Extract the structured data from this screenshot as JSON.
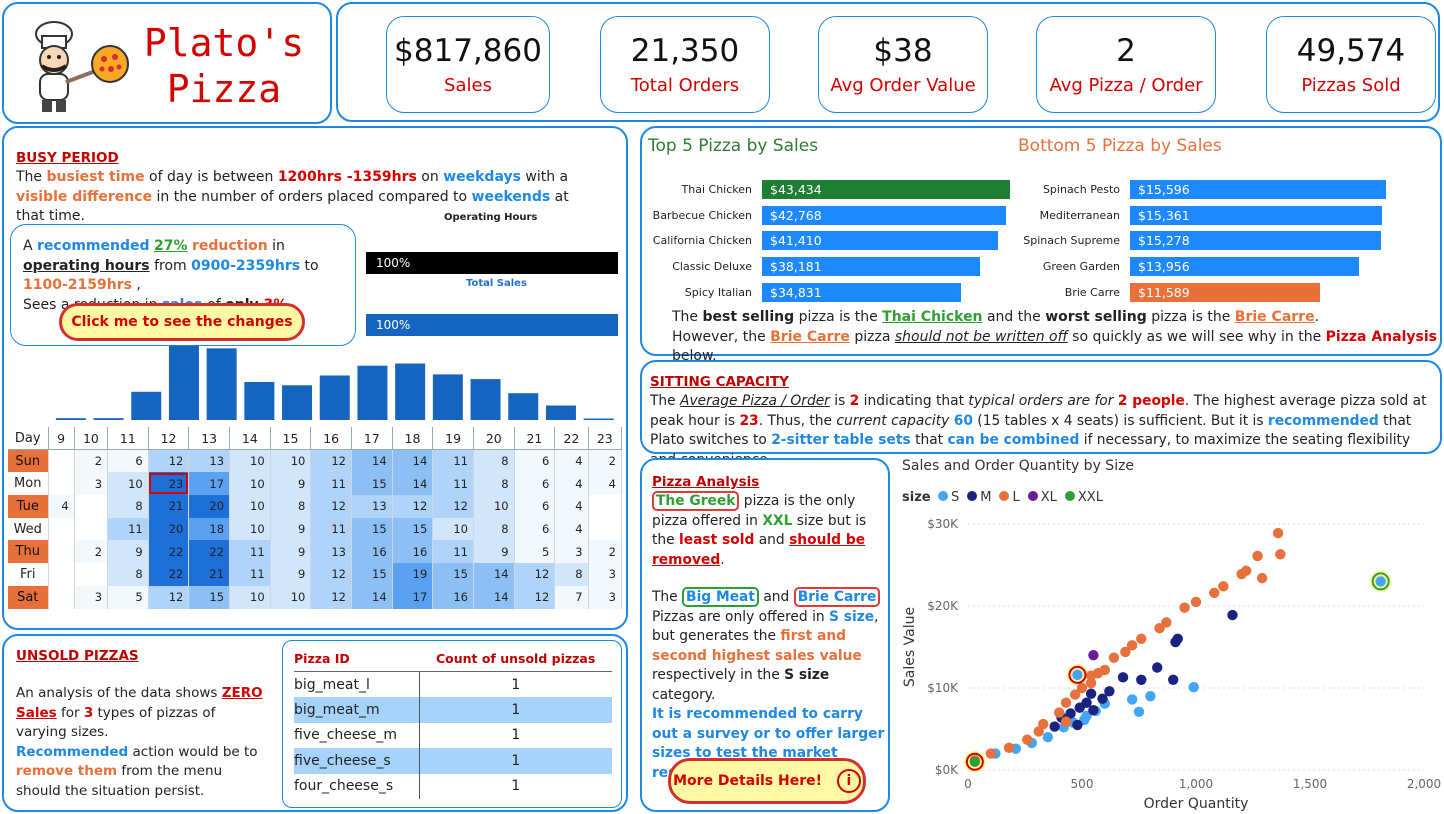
{
  "header": {
    "title_line1": "Plato's",
    "title_line2": "Pizza",
    "logo_icon": "chef-pizza-logo",
    "kpis": [
      {
        "value": "$817,860",
        "label": "Sales"
      },
      {
        "value": "21,350",
        "label": "Total Orders"
      },
      {
        "value": "$38",
        "label": "Avg Order Value"
      },
      {
        "value": "2",
        "label": "Avg Pizza / Order"
      },
      {
        "value": "49,574",
        "label": "Pizzas Sold"
      }
    ]
  },
  "busy": {
    "heading": "BUSY PERIOD",
    "p1": [
      "The ",
      "busiest time",
      " of day is between ",
      "1200hrs -1359hrs",
      " on ",
      "weekdays",
      " with a ",
      "visible difference",
      " in the number of orders placed compared to ",
      "weekends",
      " at that time."
    ],
    "rec": [
      "A ",
      "recommended",
      " ",
      "27%",
      " ",
      "reduction",
      " in ",
      "operating hours",
      " from ",
      "0900-2359hrs",
      " to ",
      "1100-2159hrs",
      " ,",
      "Sees a reduction in ",
      "sales ",
      "of ",
      "only ",
      "3%"
    ],
    "op_hours_title": "Operating Hours",
    "op_hours_value": "100%",
    "total_sales_title": "Total Sales",
    "total_sales_value": "100%",
    "button": "Click me to see the changes",
    "button_icon": "undo-arrow-icon"
  },
  "hourly_chart": {
    "type": "bar",
    "categories": [
      "9",
      "10",
      "11",
      "12",
      "13",
      "14",
      "15",
      "16",
      "17",
      "18",
      "19",
      "20",
      "21",
      "22",
      "23"
    ],
    "values": [
      0.5,
      0.5,
      7.8,
      20.5,
      19.8,
      10.5,
      9.6,
      12.3,
      15.0,
      15.6,
      12.6,
      11.3,
      7.4,
      4.0,
      0.4
    ]
  },
  "heatmap": {
    "day_label": "Day",
    "hours": [
      "9",
      "10",
      "11",
      "12",
      "13",
      "14",
      "15",
      "16",
      "17",
      "18",
      "19",
      "20",
      "21",
      "22",
      "23"
    ],
    "rows": [
      {
        "day": "Sun",
        "hl": true,
        "vals": [
          "",
          "2",
          "6",
          "12",
          "13",
          "10",
          "10",
          "12",
          "14",
          "14",
          "11",
          "8",
          "6",
          "4",
          "2"
        ]
      },
      {
        "day": "Mon",
        "hl": false,
        "vals": [
          "",
          "3",
          "10",
          "23",
          "17",
          "10",
          "9",
          "11",
          "15",
          "14",
          "11",
          "8",
          "6",
          "4",
          "4"
        ]
      },
      {
        "day": "Tue",
        "hl": true,
        "vals": [
          "4",
          "",
          "8",
          "21",
          "20",
          "10",
          "8",
          "12",
          "13",
          "12",
          "12",
          "10",
          "6",
          "4",
          ""
        ]
      },
      {
        "day": "Wed",
        "hl": false,
        "vals": [
          "",
          "",
          "11",
          "20",
          "18",
          "10",
          "9",
          "11",
          "15",
          "15",
          "10",
          "8",
          "6",
          "4",
          ""
        ]
      },
      {
        "day": "Thu",
        "hl": true,
        "vals": [
          "",
          "2",
          "9",
          "22",
          "22",
          "11",
          "9",
          "13",
          "16",
          "16",
          "11",
          "9",
          "5",
          "3",
          "2"
        ]
      },
      {
        "day": "Fri",
        "hl": false,
        "vals": [
          "",
          "",
          "8",
          "22",
          "21",
          "11",
          "9",
          "12",
          "15",
          "19",
          "15",
          "14",
          "12",
          "8",
          "3"
        ]
      },
      {
        "day": "Sat",
        "hl": true,
        "vals": [
          "",
          "3",
          "5",
          "12",
          "15",
          "10",
          "10",
          "12",
          "14",
          "17",
          "16",
          "14",
          "12",
          "7",
          "3"
        ]
      }
    ]
  },
  "unsold": {
    "heading": "UNSOLD PIZZAS",
    "p1": [
      "An analysis of the data shows ",
      "ZERO Sales",
      " for ",
      "3",
      " types of pizzas of varying sizes."
    ],
    "p2": [
      "Recommended",
      " action would be to ",
      "remove them",
      " from the menu should the situation persist."
    ],
    "col1": "Pizza ID",
    "col2": "Count of unsold pizzas",
    "rows": [
      {
        "id": "big_meat_l",
        "count": "1"
      },
      {
        "id": "big_meat_m",
        "count": "1"
      },
      {
        "id": "five_cheese_m",
        "count": "1"
      },
      {
        "id": "five_cheese_s",
        "count": "1"
      },
      {
        "id": "four_cheese_s",
        "count": "1"
      }
    ]
  },
  "top5": {
    "title": "Top 5 Pizza by Sales",
    "items": [
      {
        "name": "Thai Chicken",
        "label": "$43,434",
        "value": 43434
      },
      {
        "name": "Barbecue Chicken",
        "label": "$42,768",
        "value": 42768
      },
      {
        "name": "California Chicken",
        "label": "$41,410",
        "value": 41410
      },
      {
        "name": "Classic Deluxe",
        "label": "$38,181",
        "value": 38181
      },
      {
        "name": "Spicy Italian",
        "label": "$34,831",
        "value": 34831
      }
    ]
  },
  "bottom5": {
    "title": "Bottom 5 Pizza by Sales",
    "items": [
      {
        "name": "Spinach Pesto",
        "label": "$15,596",
        "value": 15596
      },
      {
        "name": "Mediterranean",
        "label": "$15,361",
        "value": 15361
      },
      {
        "name": "Spinach Supreme",
        "label": "$15,278",
        "value": 15278
      },
      {
        "name": "Green Garden",
        "label": "$13,956",
        "value": 13956
      },
      {
        "name": "Brie Carre",
        "label": "$11,589",
        "value": 11589
      }
    ]
  },
  "best_worst": {
    "l1": [
      "The ",
      "best selling",
      " pizza is the ",
      "Thai Chicken",
      " and the ",
      "worst selling",
      " pizza is the ",
      "Brie Carre",
      "."
    ],
    "l2": [
      "However, the ",
      "Brie Carre",
      " pizza ",
      "should not be written off",
      " so quickly as we will see why in the ",
      "Pizza Analysis",
      " below."
    ]
  },
  "sitting": {
    "heading": "SITTING CAPACITY",
    "p": [
      "The ",
      "Average Pizza / Order",
      " is ",
      "2",
      " indicating that ",
      "typical orders are for",
      " ",
      "2 people",
      ". The highest average pizza sold at peak hour is ",
      "23",
      ". Thus, the ",
      "current capacity",
      " ",
      "60",
      " (15 tables x 4 seats) is sufficient. But it is ",
      "recommended",
      " that Plato switches to ",
      "2-sitter table sets",
      " that ",
      "can be combined",
      " if necessary, to maximize the seating flexibility and convenience."
    ]
  },
  "analysis": {
    "heading": "Pizza Analysis",
    "p1": [
      "The Greek",
      " pizza is the only pizza offered in ",
      "XXL",
      " size but is the ",
      "least sold",
      " and ",
      "should be removed",
      "."
    ],
    "p2": [
      "The ",
      "Big Meat",
      " and ",
      "Brie Carre",
      " Pizzas are only offered in ",
      "S size",
      ", but generates the ",
      "first and second highest sales value",
      " respectively in the ",
      "S size",
      " category."
    ],
    "p3": "It is recommended to carry out a survey or to offer larger sizes to test the market response.",
    "button": "More Details Here!",
    "button_icon": "info-icon"
  },
  "chart_data": {
    "type": "scatter",
    "title": "Sales and Order Quantity by Size",
    "xlabel": "Order Quantity",
    "ylabel": "Sales Value",
    "legend_title": "size",
    "xlim": [
      0,
      2000
    ],
    "ylim": [
      0,
      30000
    ],
    "xticks": [
      "0",
      "500",
      "1,000",
      "1,500",
      "2,000"
    ],
    "yticks": [
      "$0K",
      "$10K",
      "$20K",
      "$30K"
    ],
    "colors": {
      "S": "#42a5f5",
      "M": "#1a237e",
      "L": "#e8703a",
      "XL": "#6a1b9a",
      "XXL": "#2e9e35"
    },
    "series": [
      {
        "name": "S",
        "points": [
          [
            480,
            11600
          ],
          [
            1810,
            23000
          ],
          [
            210,
            2600
          ],
          [
            350,
            4000
          ],
          [
            420,
            5200
          ],
          [
            460,
            5800
          ],
          [
            510,
            6100
          ],
          [
            560,
            7200
          ],
          [
            600,
            8100
          ],
          [
            720,
            8600
          ],
          [
            750,
            7100
          ],
          [
            800,
            9000
          ],
          [
            990,
            10100
          ],
          [
            120,
            2000
          ],
          [
            280,
            3300
          ],
          [
            520,
            6600
          ]
        ]
      },
      {
        "name": "M",
        "points": [
          [
            380,
            5300
          ],
          [
            410,
            6400
          ],
          [
            450,
            6900
          ],
          [
            490,
            7600
          ],
          [
            520,
            8200
          ],
          [
            550,
            7300
          ],
          [
            590,
            8700
          ],
          [
            620,
            9600
          ],
          [
            680,
            11300
          ],
          [
            760,
            11000
          ],
          [
            830,
            12500
          ],
          [
            910,
            15600
          ],
          [
            920,
            16000
          ],
          [
            1160,
            18900
          ],
          [
            900,
            11000
          ],
          [
            480,
            5500
          ],
          [
            540,
            9300
          ]
        ]
      },
      {
        "name": "L",
        "points": [
          [
            30,
            1200
          ],
          [
            100,
            2000
          ],
          [
            180,
            2700
          ],
          [
            260,
            3700
          ],
          [
            310,
            4700
          ],
          [
            400,
            7000
          ],
          [
            430,
            8200
          ],
          [
            470,
            9200
          ],
          [
            500,
            10000
          ],
          [
            540,
            10600
          ],
          [
            570,
            11800
          ],
          [
            600,
            12200
          ],
          [
            640,
            13700
          ],
          [
            690,
            14400
          ],
          [
            720,
            15200
          ],
          [
            760,
            16000
          ],
          [
            840,
            17300
          ],
          [
            870,
            18000
          ],
          [
            950,
            19800
          ],
          [
            1000,
            20500
          ],
          [
            1080,
            21600
          ],
          [
            1120,
            22400
          ],
          [
            1200,
            23900
          ],
          [
            1220,
            24300
          ],
          [
            1270,
            26100
          ],
          [
            1360,
            28900
          ],
          [
            1370,
            26300
          ],
          [
            1290,
            23400
          ],
          [
            540,
            11500
          ],
          [
            330,
            5600
          ],
          [
            430,
            5900
          ]
        ]
      },
      {
        "name": "XL",
        "points": [
          [
            550,
            14000
          ]
        ]
      },
      {
        "name": "XXL",
        "points": [
          [
            30,
            1000
          ]
        ]
      }
    ],
    "highlighted": [
      [
        30,
        1000
      ],
      [
        480,
        11600
      ],
      [
        1810,
        23000
      ]
    ]
  }
}
